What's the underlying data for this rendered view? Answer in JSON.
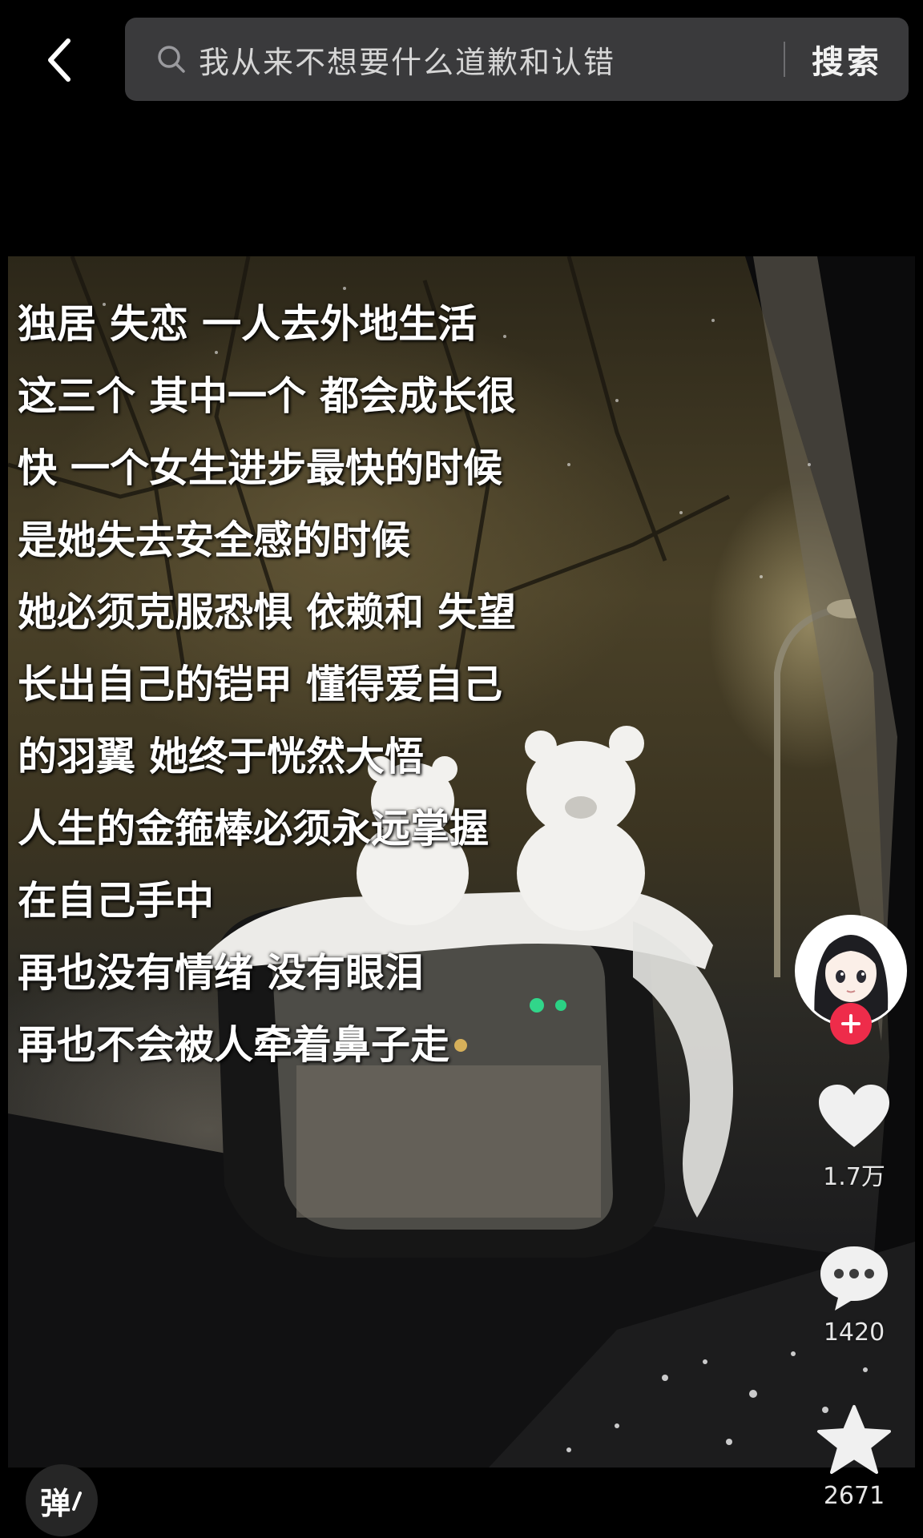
{
  "header": {
    "back_icon": "chevron-left-icon",
    "search_icon": "search-icon",
    "search_query": "我从来不想要什么道歉和认错",
    "search_button_label": "搜索"
  },
  "video": {
    "caption_lines": [
      "独居 失恋 一人去外地生活",
      "这三个 其中一个 都会成长很",
      "快 一个女生进步最快的时候",
      "是她失去安全感的时候",
      "她必须克服恐惧 依赖和 失望",
      "长出自己的铠甲 懂得爱自己",
      "的羽翼 她终于恍然大悟",
      "人生的金箍棒必须永远掌握",
      "在自己手中",
      "再也没有情绪 没有眼泪",
      "再也不会被人牵着鼻子走"
    ]
  },
  "rail": {
    "avatar_icon": "anime-girl-avatar",
    "follow_icon": "plus-icon",
    "likes": {
      "icon": "heart-icon",
      "count": "1.7万"
    },
    "comments": {
      "icon": "comment-bubble-icon",
      "count": "1420"
    },
    "favorites": {
      "icon": "star-icon",
      "count": "2671"
    }
  },
  "danmaku": {
    "label": "弹",
    "icon": "danmaku-toggle-icon"
  },
  "colors": {
    "background": "#000000",
    "search_bar": "#3a3a3c",
    "follow_badge": "#ee2c4a",
    "icon_fill": "#f0f0f0"
  }
}
